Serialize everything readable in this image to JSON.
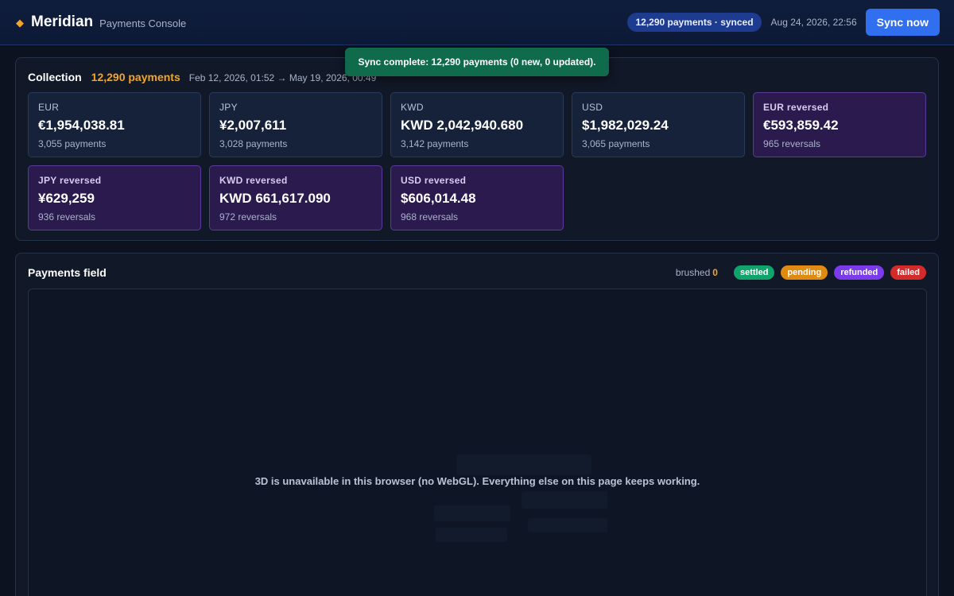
{
  "header": {
    "brand_icon": "diamond-icon",
    "brand_name": "Meridian",
    "brand_sub": "Payments Console",
    "sync_badge": "12,290 payments · synced",
    "timestamp": "Aug 24, 2026, 22:56",
    "sync_button": "Sync now"
  },
  "toast": {
    "message": "Sync complete: 12,290 payments (0 new, 0 updated)."
  },
  "collection": {
    "title": "Collection",
    "count": "12,290 payments",
    "date_range": "Feb 12, 2026, 01:52 → May 19, 2026, 00:49",
    "cards": [
      {
        "label": "EUR",
        "value": "€1,954,038.81",
        "sub": "3,055 payments"
      },
      {
        "label": "JPY",
        "value": "¥2,007,611",
        "sub": "3,028 payments"
      },
      {
        "label": "KWD",
        "value": "KWD 2,042,940.680",
        "sub": "3,142 payments"
      },
      {
        "label": "USD",
        "value": "$1,982,029.24",
        "sub": "3,065 payments"
      },
      {
        "label": "EUR reversed",
        "value": "€593,859.42",
        "sub": "965 reversals"
      },
      {
        "label": "JPY reversed",
        "value": "¥629,259",
        "sub": "936 reversals"
      },
      {
        "label": "KWD reversed",
        "value": "KWD 661,617.090",
        "sub": "972 reversals"
      },
      {
        "label": "USD reversed",
        "value": "$606,014.48",
        "sub": "968 reversals"
      }
    ]
  },
  "field": {
    "title": "Payments field",
    "brushed_label": "brushed",
    "brushed_count": "0",
    "legend": [
      "settled",
      "pending",
      "refunded",
      "failed"
    ],
    "webgl_message": "3D is unavailable in this browser (no WebGL). Everything else on this page keeps working."
  },
  "colors": {
    "accent": "#f5a524",
    "primary": "#2f6ff0",
    "settled": "#10a36b",
    "pending": "#e08a12",
    "refunded": "#7c3aed",
    "failed": "#d42a2a",
    "toast": "#0f6b4b"
  }
}
